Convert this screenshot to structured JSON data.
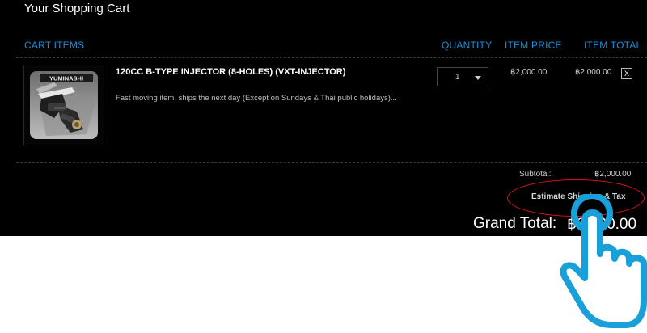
{
  "cart": {
    "title": "Your Shopping Cart",
    "columns": {
      "items": "CART ITEMS",
      "quantity": "QUANTITY",
      "item_price": "ITEM PRICE",
      "item_total": "ITEM TOTAL"
    },
    "items": [
      {
        "name": "120CC B-TYPE INJECTOR (8-HOLES) (VXT-INJECTOR)",
        "note": "Fast moving item, ships the next day (Except on Sundays & Thai public holidays)...",
        "thumbnail_brand": "YUMINASHI",
        "quantity": "1",
        "price": "฿2,000.00",
        "total": "฿2,000.00",
        "remove_label": "X"
      }
    ],
    "subtotal_label": "Subtotal:",
    "subtotal_value": "฿2,000.00",
    "estimate_label": "Estimate Shipping & Tax",
    "grand_total_label": "Grand Total:",
    "grand_total_value": "฿2,000.00"
  },
  "colors": {
    "background": "#000000",
    "column_header": "#1b8fd8",
    "highlight_ring": "#e0141b",
    "pointer_hand": "#1aa0d8"
  },
  "icons": {
    "quantity_dropdown": "chevron-down-icon",
    "remove": "close-icon",
    "pointer": "pointing-hand-icon"
  }
}
